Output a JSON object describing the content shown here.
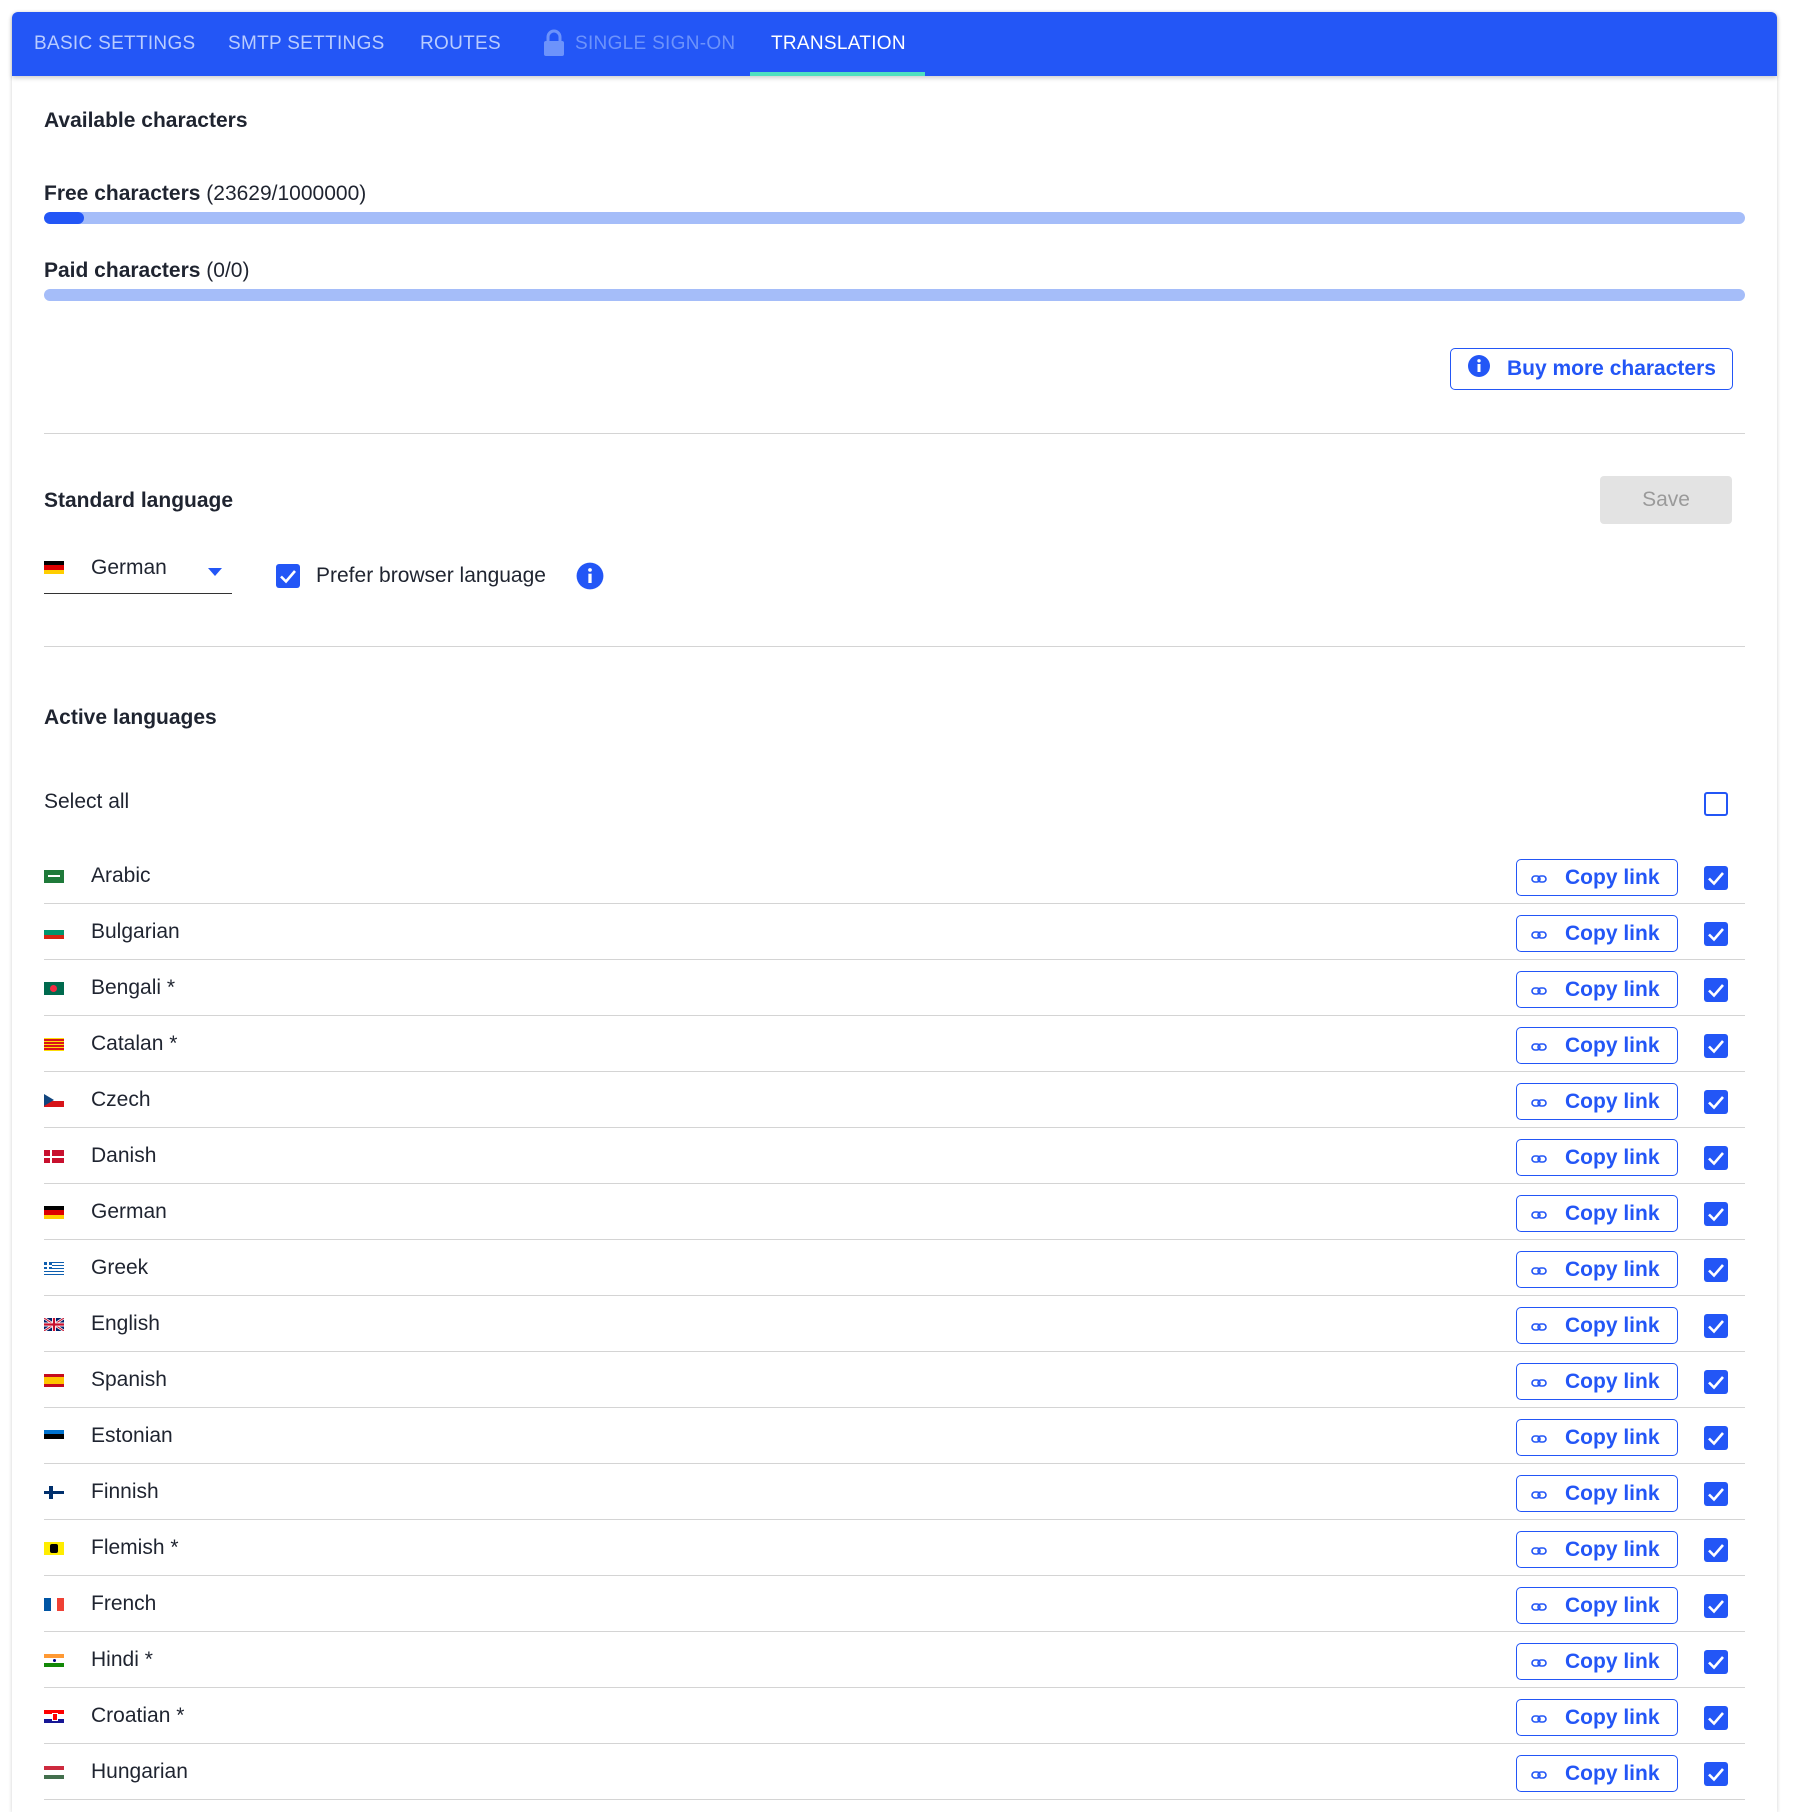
{
  "tabs": [
    {
      "label": "BASIC SETTINGS"
    },
    {
      "label": "SMTP SETTINGS"
    },
    {
      "label": "ROUTES"
    },
    {
      "label": "SINGLE SIGN-ON"
    },
    {
      "label": "TRANSLATION"
    }
  ],
  "colors": {
    "primary": "#2356f6",
    "progress_track": "#a5bdf9",
    "tab_underline": "#4fe0c0",
    "disabled_button": "#e3e3e3"
  },
  "available": {
    "title": "Available characters",
    "free_label": "Free characters",
    "free_count": "(23629/1000000)",
    "free_progress": 0.0236,
    "paid_label": "Paid characters",
    "paid_count": "(0/0)",
    "paid_progress": 0,
    "buy_button": "Buy more characters"
  },
  "standard": {
    "title": "Standard language",
    "save_button": "Save",
    "selected_language": "German",
    "prefer_browser_label": "Prefer browser language",
    "prefer_browser_checked": true
  },
  "active": {
    "title": "Active languages",
    "select_all_label": "Select all",
    "select_all_checked": false,
    "copy_label": "Copy link",
    "languages": [
      {
        "name": "Arabic",
        "flag": "sa-flag",
        "checked": true
      },
      {
        "name": "Bulgarian",
        "flag": "bg-flag",
        "checked": true
      },
      {
        "name": "Bengali *",
        "flag": "bd-flag",
        "checked": true
      },
      {
        "name": "Catalan *",
        "flag": "catalonia-flag",
        "checked": true
      },
      {
        "name": "Czech",
        "flag": "cz-flag",
        "checked": true
      },
      {
        "name": "Danish",
        "flag": "dk-flag",
        "checked": true
      },
      {
        "name": "German",
        "flag": "de-flag",
        "checked": true
      },
      {
        "name": "Greek",
        "flag": "gr-flag",
        "checked": true
      },
      {
        "name": "English",
        "flag": "gb-flag",
        "checked": true
      },
      {
        "name": "Spanish",
        "flag": "es-flag",
        "checked": true
      },
      {
        "name": "Estonian",
        "flag": "ee-flag",
        "checked": true
      },
      {
        "name": "Finnish",
        "flag": "fi-flag",
        "checked": true
      },
      {
        "name": "Flemish *",
        "flag": "flanders-flag",
        "checked": true
      },
      {
        "name": "French",
        "flag": "fr-flag",
        "checked": true
      },
      {
        "name": "Hindi *",
        "flag": "in-flag",
        "checked": true
      },
      {
        "name": "Croatian *",
        "flag": "hr-flag",
        "checked": true
      },
      {
        "name": "Hungarian",
        "flag": "hu-flag",
        "checked": true
      }
    ]
  }
}
